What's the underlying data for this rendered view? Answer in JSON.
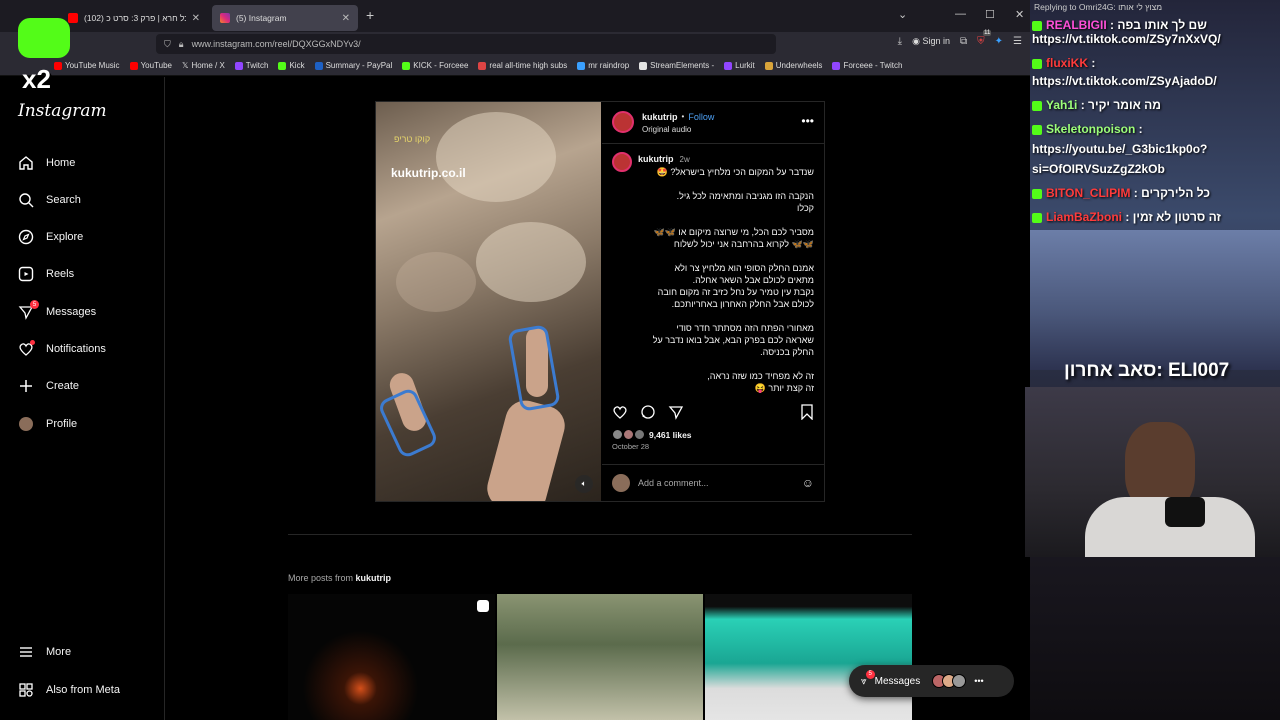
{
  "browser": {
    "tabs": [
      {
        "title": "(102) הכל חרא | פרק 3: סרט כ",
        "active": false
      },
      {
        "title": "(5) Instagram",
        "active": true
      }
    ],
    "url": "www.instagram.com/reel/DQXGGxNDYv3/",
    "sign_in": "Sign in",
    "ext_badge": "11",
    "bookmarks": [
      "YouTube Music",
      "YouTube",
      "Home / X",
      "Twitch",
      "Kick",
      "Summary - PayPal",
      "KICK - Forceee",
      "real all-time high subs",
      "mr raindrop",
      "StreamElements -",
      "Lurkit",
      "Underwheels",
      "Forceee - Twitch"
    ]
  },
  "sidebar": {
    "logo": "Instagram",
    "items": [
      {
        "label": "Home",
        "icon": "home-icon"
      },
      {
        "label": "Search",
        "icon": "search-icon"
      },
      {
        "label": "Explore",
        "icon": "compass-icon"
      },
      {
        "label": "Reels",
        "icon": "reels-icon"
      },
      {
        "label": "Messages",
        "icon": "messenger-icon",
        "badge": "5"
      },
      {
        "label": "Notifications",
        "icon": "heart-icon"
      },
      {
        "label": "Create",
        "icon": "plus-icon"
      },
      {
        "label": "Profile",
        "icon": "avatar-icon"
      }
    ],
    "more": "More",
    "meta": "Also from Meta"
  },
  "post": {
    "username": "kukutrip",
    "follow": "Follow",
    "audio": "Original audio",
    "caption_user": "kukutrip",
    "caption_age": "2w",
    "video_watermark": "kukutrip.co.il",
    "video_logo": "קוקו טריפ",
    "caption_lines": [
      "שנדבר על המקום הכי מלחיץ בישראל? 🤩",
      "",
      "הנקבה הזו מגניבה ומתאימה לכל גיל.",
      "קכלו",
      "",
      "מסביר לכם הכל, מי שרוצה מיקום או 🦋🦋",
      "🦋🦋 לקרוא בהרחבה אני יכול לשלוח",
      "",
      "אמנם החלק הסופי הוא מלחיץ צר ולא",
      "מתאים לכולם אבל השאר אחלה.",
      "נקבת עין טמיר על נחל כזיב זה מקום חובה",
      "לכולם אבל החלק האחרון באחריותכם.",
      "",
      "מאחורי הפתח הזה מסתתר חדר סודי",
      "שאראה לכם בפרק הבא, אבל בואו נדבר על",
      "החלק בכניסה.",
      "",
      "זה לא מפחיד כמו שזה נראה,",
      "זה קצת יותר 😝"
    ],
    "likes": "9,461 likes",
    "date": "October 28",
    "comment_placeholder": "Add a comment..."
  },
  "more_posts": {
    "prefix": "More posts from",
    "user": "kukutrip"
  },
  "messages_pill": {
    "label": "Messages",
    "badge": "5"
  },
  "stream": {
    "reply_header": "Replying to Omri24G: מצוץ לי אותו",
    "chat": [
      {
        "user": "REALBIGII",
        "text": "שם לך אותו בפה",
        "color": "#ff4fd8"
      },
      {
        "user": "",
        "text": "https://vt.tiktok.com/ZSy7nXxVQ/",
        "color": "#ffffff"
      },
      {
        "user": "fluxiKK",
        "text": "",
        "color": "#ff3b3b"
      },
      {
        "user": "",
        "text": "https://vt.tiktok.com/ZSyAjadoD/",
        "color": "#ffffff"
      },
      {
        "user": "Yah1i",
        "text": "מה אומר יקיר",
        "color": "#9dff7a"
      },
      {
        "user": "Skeletonpoison",
        "text": "",
        "color": "#9dff7a"
      },
      {
        "user": "",
        "text": "https://youtu.be/_G3bic1kp0o?",
        "color": "#ffffff"
      },
      {
        "user": "",
        "text": "si=OfOIRVSuzZgZ2kOb",
        "color": "#ffffff"
      },
      {
        "user": "BITON_CLIPIM",
        "text": "כל הלירקרים",
        "color": "#ff3b3b"
      },
      {
        "user": "LiamBaZboni",
        "text": "זה סרטון לא זמין",
        "color": "#ff3b3b"
      }
    ],
    "last_sub_label": "סאב אחרון: ELI007",
    "kick_multiplier": "x2"
  },
  "colors": {
    "accent_blue": "#4ea1f5",
    "badge_red": "#ff3040",
    "kick_green": "#53fc18"
  }
}
